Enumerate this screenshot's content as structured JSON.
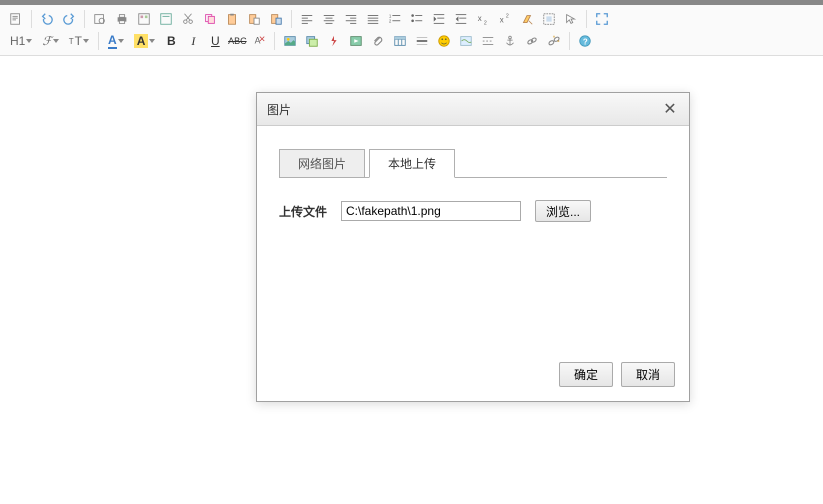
{
  "toolbar": {
    "row1_heading": "H1",
    "row2_fontcolor": "A",
    "row2_bgcolor": "A",
    "row2_bold": "B",
    "row2_italic": "I",
    "row2_underline": "U",
    "row2_strike": "ABC"
  },
  "dialog": {
    "title": "图片",
    "tabs": {
      "network": "网络图片",
      "local": "本地上传"
    },
    "upload_label": "上传文件",
    "file_value": "C:\\fakepath\\1.png",
    "browse": "浏览...",
    "ok": "确定",
    "cancel": "取消"
  }
}
